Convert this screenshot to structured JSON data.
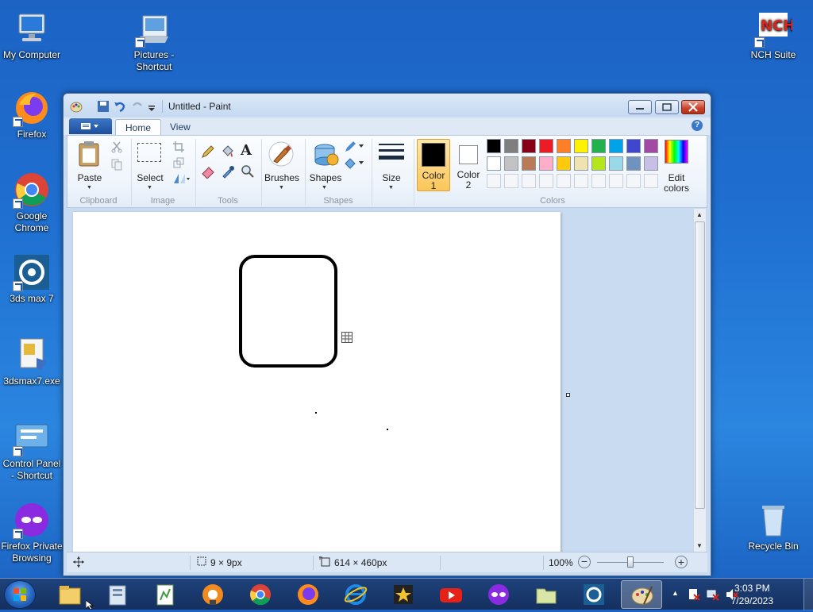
{
  "desktop": {
    "icons": [
      {
        "label": "My Computer",
        "icon": "computer-icon"
      },
      {
        "label": "Pictures - Shortcut",
        "icon": "pictures-folder-icon"
      },
      {
        "label": "NCH Suite",
        "icon": "nch-icon"
      },
      {
        "label": "Firefox",
        "icon": "firefox-icon"
      },
      {
        "label": "Google Chrome",
        "icon": "chrome-icon"
      },
      {
        "label": "3ds max 7",
        "icon": "3dsmax-icon"
      },
      {
        "label": "3dsmax7.exe",
        "icon": "exe-icon"
      },
      {
        "label": "Control Panel - Shortcut",
        "icon": "control-panel-icon"
      },
      {
        "label": "Firefox Private Browsing",
        "icon": "firefox-private-icon"
      },
      {
        "label": "Recycle Bin",
        "icon": "recycle-bin-icon"
      }
    ]
  },
  "window": {
    "title": "Untitled - Paint",
    "tabs": [
      {
        "label": "Home",
        "active": true
      },
      {
        "label": "View",
        "active": false
      }
    ],
    "ribbon": {
      "groups": {
        "clipboard": "Clipboard",
        "image": "Image",
        "tools": "Tools",
        "shapes": "Shapes",
        "colors": "Colors"
      },
      "buttons": {
        "paste": "Paste",
        "select": "Select",
        "brushes": "Brushes",
        "shapes": "Shapes",
        "size": "Size",
        "color1_line1": "Color",
        "color1_line2": "1",
        "color2_line1": "Color",
        "color2_line2": "2",
        "edit_colors_line1": "Edit",
        "edit_colors_line2": "colors"
      },
      "color1": "#000000",
      "color2": "#ffffff",
      "palette": [
        "#000000",
        "#7f7f7f",
        "#880015",
        "#ed1c24",
        "#ff7f27",
        "#fff200",
        "#22b14c",
        "#00a2e8",
        "#3f48cc",
        "#a349a4",
        "#ffffff",
        "#c3c3c3",
        "#b97a57",
        "#ffaec9",
        "#ffc90e",
        "#efe4b0",
        "#b5e61d",
        "#99d9ea",
        "#7092be",
        "#c8bfe7"
      ]
    },
    "statusbar": {
      "selection_size": "9 × 9px",
      "image_size": "614 × 460px",
      "zoom": "100%",
      "zoom_level": 0.5
    }
  },
  "taskbar": {
    "items": [
      "file-explorer-icon",
      "library-icon",
      "notepad-plus-icon",
      "firefox-private-icon",
      "chrome-icon",
      "firefox-icon",
      "ie-icon",
      "movie-maker-icon",
      "youtube-icon",
      "firefox-mask-icon",
      "folder-icon",
      "3dsmax-icon",
      "paint-icon"
    ],
    "time": "3:03 PM",
    "date": "7/29/2023"
  }
}
